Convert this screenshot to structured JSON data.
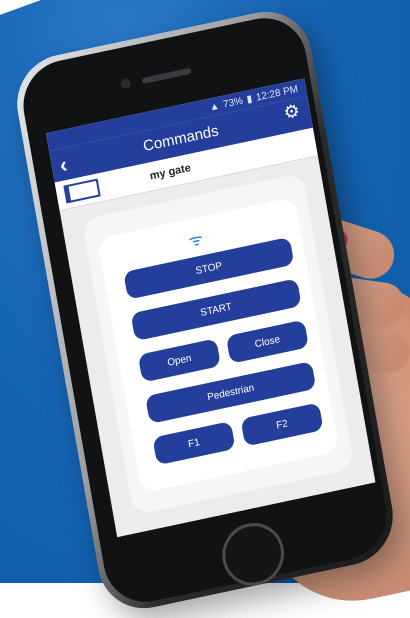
{
  "statusbar": {
    "battery": "73%",
    "time": "12:28 PM"
  },
  "header": {
    "title": "Commands",
    "back_icon": "chevron-left-icon",
    "settings_icon": "gear-icon"
  },
  "device": {
    "name": "my gate",
    "icon": "gate-icon"
  },
  "panel": {
    "wifi_icon": "wifi-icon"
  },
  "commands": {
    "stop": "STOP",
    "start": "START",
    "open": "Open",
    "close": "Close",
    "pedestrian": "Pedestrian",
    "f1": "F1",
    "f2": "F2"
  },
  "colors": {
    "background": "#1565b5",
    "appbar": "#243f9b",
    "button": "#243f9b",
    "wifi": "#1f7fe0"
  }
}
